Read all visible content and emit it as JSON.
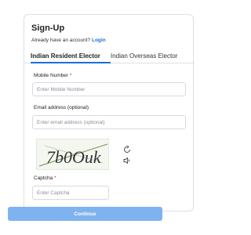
{
  "form": {
    "title": "Sign-Up",
    "account_prompt": "Already have an account?",
    "login_label": "Login"
  },
  "tabs": [
    {
      "label": "Indian Resident Elector",
      "active": true
    },
    {
      "label": "Indian Overseas Elector",
      "active": false
    }
  ],
  "fields": {
    "mobile": {
      "label": "Mobile Number",
      "required_mark": "*",
      "placeholder": "Enter Mobile Number",
      "value": ""
    },
    "email": {
      "label": "Email address (optional)",
      "placeholder": "Enter email address (optional)",
      "value": ""
    },
    "captcha": {
      "label": "Captcha",
      "required_mark": "*",
      "placeholder": "Enter Captcha",
      "value": ""
    }
  },
  "captcha_image": {
    "text": "7b0Ouk"
  },
  "icons": {
    "refresh": "refresh-icon",
    "audio": "speaker-icon"
  },
  "actions": {
    "continue_label": "Continue"
  },
  "colors": {
    "accent": "#1a6fd6",
    "button": "#7fb3f0",
    "required": "#d32f2f"
  }
}
